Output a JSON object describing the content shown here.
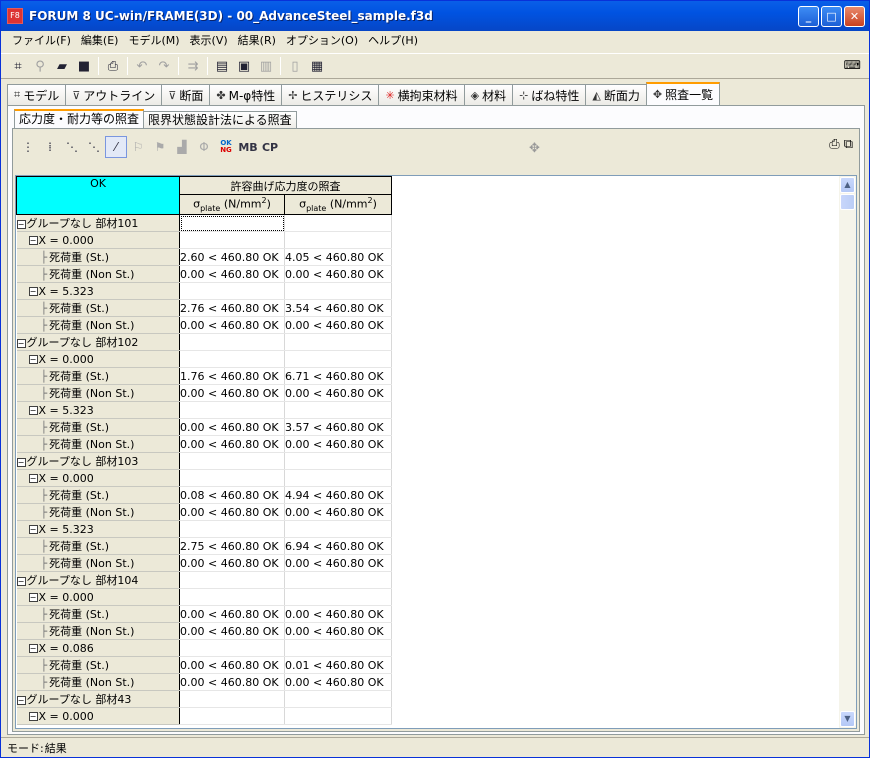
{
  "window": {
    "title": "FORUM 8  UC-win/FRAME(3D) - 00_AdvanceSteel_sample.f3d",
    "app_icon": "F8"
  },
  "menu": [
    "ファイル(F)",
    "編集(E)",
    "モデル(M)",
    "表示(V)",
    "結果(R)",
    "オプション(O)",
    "ヘルプ(H)"
  ],
  "tabs": [
    {
      "label": "モデル",
      "icon": "model-icon"
    },
    {
      "label": "アウトライン",
      "icon": "outline-icon"
    },
    {
      "label": "断面",
      "icon": "section-icon"
    },
    {
      "label": "M-φ特性",
      "icon": "m-phi-icon"
    },
    {
      "label": "ヒステリシス",
      "icon": "hysteresis-icon"
    },
    {
      "label": "横拘束材料",
      "icon": "lateral-material-icon"
    },
    {
      "label": "材料",
      "icon": "material-icon"
    },
    {
      "label": "ばね特性",
      "icon": "spring-icon"
    },
    {
      "label": "断面力",
      "icon": "section-force-icon"
    },
    {
      "label": "照査一覧",
      "icon": "check-list-icon",
      "active": true
    }
  ],
  "subtabs": [
    {
      "label": "応力度・耐力等の照査",
      "active": true
    },
    {
      "label": "限界状態設計法による照査",
      "active": false
    }
  ],
  "toolbar2": {
    "mb": "MB",
    "cp": "CP",
    "okng_top": "OK",
    "okng_bottom": "NG"
  },
  "grid": {
    "ok_header": "OK",
    "group_header": "許容曲げ応力度の照査",
    "col1_symbol": "σ",
    "col1_sub": "plate",
    "col1_unit": " (N/mm",
    "col1_sup": "2",
    "col1_close": ")",
    "col2_symbol": "σ",
    "col2_sub": "plate",
    "col2_unit": " (N/mm",
    "col2_sup": "2",
    "col2_close": ")",
    "rows": [
      {
        "level": 1,
        "label": "グループなし 部材101",
        "v1": "",
        "v2": ""
      },
      {
        "level": 2,
        "label": "X = 0.000",
        "v1": "",
        "v2": ""
      },
      {
        "level": 3,
        "label": "死荷重 (St.)",
        "v1": "2.60 < 460.80 OK",
        "v2": "4.05 < 460.80 OK"
      },
      {
        "level": 3,
        "label": "死荷重 (Non St.)",
        "v1": "0.00 < 460.80 OK",
        "v2": "0.00 < 460.80 OK"
      },
      {
        "level": 2,
        "label": "X = 5.323",
        "v1": "",
        "v2": ""
      },
      {
        "level": 3,
        "label": "死荷重 (St.)",
        "v1": "2.76 < 460.80 OK",
        "v2": "3.54 < 460.80 OK"
      },
      {
        "level": 3,
        "label": "死荷重 (Non St.)",
        "v1": "0.00 < 460.80 OK",
        "v2": "0.00 < 460.80 OK"
      },
      {
        "level": 1,
        "label": "グループなし 部材102",
        "v1": "",
        "v2": ""
      },
      {
        "level": 2,
        "label": "X = 0.000",
        "v1": "",
        "v2": ""
      },
      {
        "level": 3,
        "label": "死荷重 (St.)",
        "v1": "1.76 < 460.80 OK",
        "v2": "6.71 < 460.80 OK"
      },
      {
        "level": 3,
        "label": "死荷重 (Non St.)",
        "v1": "0.00 < 460.80 OK",
        "v2": "0.00 < 460.80 OK"
      },
      {
        "level": 2,
        "label": "X = 5.323",
        "v1": "",
        "v2": ""
      },
      {
        "level": 3,
        "label": "死荷重 (St.)",
        "v1": "0.00 < 460.80 OK",
        "v2": "3.57 < 460.80 OK"
      },
      {
        "level": 3,
        "label": "死荷重 (Non St.)",
        "v1": "0.00 < 460.80 OK",
        "v2": "0.00 < 460.80 OK"
      },
      {
        "level": 1,
        "label": "グループなし 部材103",
        "v1": "",
        "v2": ""
      },
      {
        "level": 2,
        "label": "X = 0.000",
        "v1": "",
        "v2": ""
      },
      {
        "level": 3,
        "label": "死荷重 (St.)",
        "v1": "0.08 < 460.80 OK",
        "v2": "4.94 < 460.80 OK"
      },
      {
        "level": 3,
        "label": "死荷重 (Non St.)",
        "v1": "0.00 < 460.80 OK",
        "v2": "0.00 < 460.80 OK"
      },
      {
        "level": 2,
        "label": "X = 5.323",
        "v1": "",
        "v2": ""
      },
      {
        "level": 3,
        "label": "死荷重 (St.)",
        "v1": "2.75 < 460.80 OK",
        "v2": "6.94 < 460.80 OK"
      },
      {
        "level": 3,
        "label": "死荷重 (Non St.)",
        "v1": "0.00 < 460.80 OK",
        "v2": "0.00 < 460.80 OK"
      },
      {
        "level": 1,
        "label": "グループなし 部材104",
        "v1": "",
        "v2": ""
      },
      {
        "level": 2,
        "label": "X = 0.000",
        "v1": "",
        "v2": ""
      },
      {
        "level": 3,
        "label": "死荷重 (St.)",
        "v1": "0.00 < 460.80 OK",
        "v2": "0.00 < 460.80 OK"
      },
      {
        "level": 3,
        "label": "死荷重 (Non St.)",
        "v1": "0.00 < 460.80 OK",
        "v2": "0.00 < 460.80 OK"
      },
      {
        "level": 2,
        "label": "X = 0.086",
        "v1": "",
        "v2": ""
      },
      {
        "level": 3,
        "label": "死荷重 (St.)",
        "v1": "0.00 < 460.80 OK",
        "v2": "0.01 < 460.80 OK"
      },
      {
        "level": 3,
        "label": "死荷重 (Non St.)",
        "v1": "0.00 < 460.80 OK",
        "v2": "0.00 < 460.80 OK"
      },
      {
        "level": 1,
        "label": "グループなし 部材43",
        "v1": "",
        "v2": ""
      },
      {
        "level": 2,
        "label": "X = 0.000",
        "v1": "",
        "v2": ""
      }
    ]
  },
  "status": {
    "label": "モード:",
    "value": "結果"
  },
  "colors": {
    "ok_header": "#00ffff",
    "titlebar": "#0053e1",
    "active_tab_border": "#ff9c00"
  }
}
